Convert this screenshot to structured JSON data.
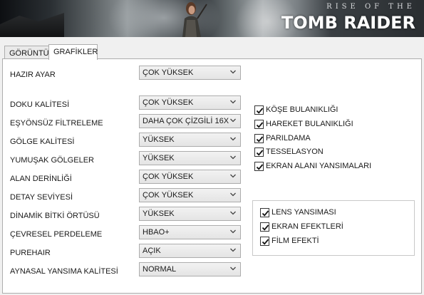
{
  "banner": {
    "logo_top": "RISE OF THE",
    "logo_main": "TOMB RAIDER"
  },
  "tabs": [
    {
      "label": "GÖRÜNTÜ",
      "active": false
    },
    {
      "label": "GRAFİKLER",
      "active": true
    }
  ],
  "settings": [
    {
      "label": "HAZIR AYAR",
      "value": "ÇOK YÜKSEK"
    },
    {
      "label": "DOKU KALİTESİ",
      "value": "ÇOK YÜKSEK"
    },
    {
      "label": "EŞYÖNSÜZ FİLTRELEME",
      "value": "DAHA ÇOK ÇİZGİLİ 16X"
    },
    {
      "label": "GÖLGE KALİTESİ",
      "value": "YÜKSEK"
    },
    {
      "label": "YUMUŞAK GÖLGELER",
      "value": "YÜKSEK"
    },
    {
      "label": "ALAN DERİNLİĞİ",
      "value": "ÇOK YÜKSEK"
    },
    {
      "label": "DETAY SEVİYESİ",
      "value": "ÇOK YÜKSEK"
    },
    {
      "label": "DİNAMİK BİTKİ ÖRTÜSÜ",
      "value": "YÜKSEK"
    },
    {
      "label": "ÇEVRESEL PERDELEME",
      "value": "HBAO+"
    },
    {
      "label": "PUREHAIR",
      "value": "AÇIK"
    },
    {
      "label": "AYNASAL YANSIMA KALİTESİ",
      "value": "NORMAL"
    }
  ],
  "checkboxes": [
    {
      "label": "KÖŞE BULANIKLIĞI",
      "checked": true
    },
    {
      "label": "HAREKET BULANIKLIĞI",
      "checked": true
    },
    {
      "label": "PARILDAMA",
      "checked": true
    },
    {
      "label": "TESSELASYON",
      "checked": true
    },
    {
      "label": "EKRAN ALANI YANSIMALARI",
      "checked": true
    }
  ],
  "group_checkboxes": [
    {
      "label": "LENS YANSIMASI",
      "checked": true
    },
    {
      "label": "EKRAN EFEKTLERİ",
      "checked": true
    },
    {
      "label": "FİLM EFEKTİ",
      "checked": true
    }
  ],
  "icons": {
    "dropdown": "chevron-down-icon",
    "check": "checkmark-icon"
  }
}
